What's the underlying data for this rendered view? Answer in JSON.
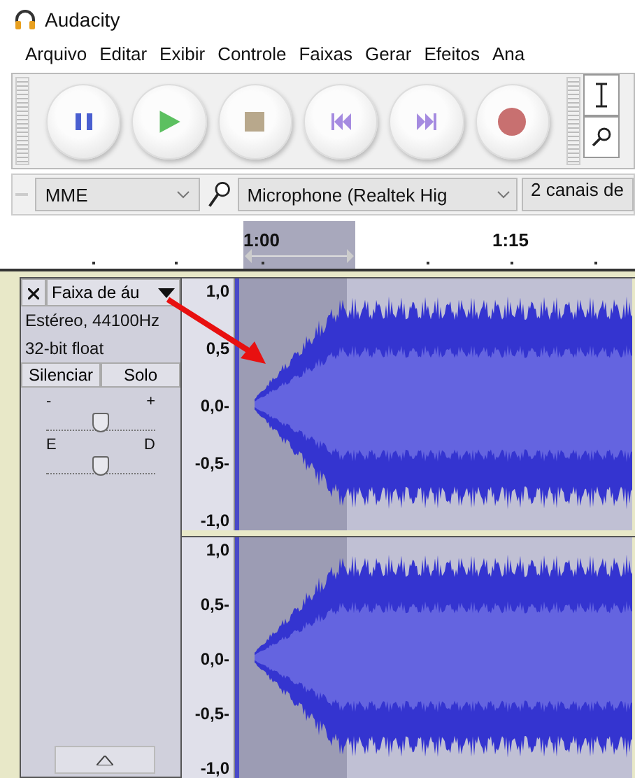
{
  "window": {
    "title": "Audacity"
  },
  "menu": [
    "Arquivo",
    "Editar",
    "Exibir",
    "Controle",
    "Faixas",
    "Gerar",
    "Efeitos",
    "Ana"
  ],
  "transport": [
    {
      "kind": "pause"
    },
    {
      "kind": "play"
    },
    {
      "kind": "stop"
    },
    {
      "kind": "start"
    },
    {
      "kind": "end"
    },
    {
      "kind": "record"
    }
  ],
  "tools": [
    {
      "kind": "select"
    },
    {
      "kind": "zoom"
    }
  ],
  "device": {
    "host": "MME",
    "input": "Microphone (Realtek Hig",
    "channels": "2 canais de"
  },
  "ruler": {
    "labels": [
      "1:00",
      "1:15"
    ]
  },
  "track": {
    "name": "Faixa de áu",
    "info": [
      "Estéreo, 44100Hz",
      "32-bit float"
    ],
    "mute": "Silenciar",
    "solo": "Solo",
    "gain": {
      "minus": "-",
      "plus": "+",
      "level": 0.5
    },
    "pan": {
      "left": "E",
      "right": "D",
      "level": 0.5
    },
    "channels": [
      {
        "scale": [
          "1,0",
          "0,5",
          "0,0-",
          "-0,5-",
          "-1,0"
        ]
      },
      {
        "scale": [
          "1,0",
          "0,5-",
          "0,0-",
          "-0,5-",
          "-1,0"
        ]
      }
    ]
  }
}
